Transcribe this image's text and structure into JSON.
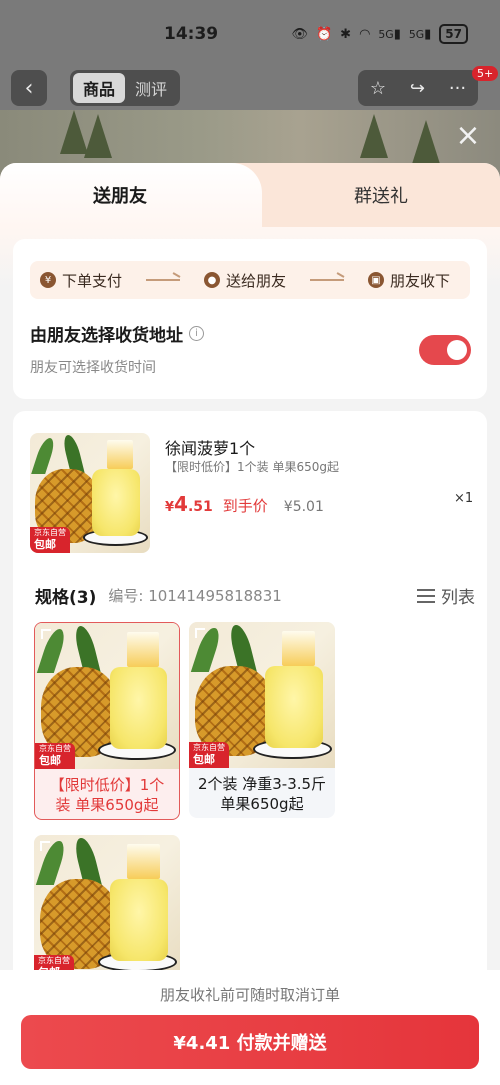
{
  "status_bar": {
    "time": "14:39",
    "battery": "57",
    "signal": "5G"
  },
  "top_nav": {
    "tabs": [
      {
        "label": "商品",
        "active": true
      },
      {
        "label": "测评",
        "active": false
      }
    ],
    "badge": "5+"
  },
  "sheet": {
    "tabs": [
      {
        "label": "送朋友",
        "active": true
      },
      {
        "label": "群送礼",
        "active": false
      }
    ],
    "flow": [
      {
        "label": "下单支付",
        "icon": "yuan-icon"
      },
      {
        "label": "送给朋友",
        "icon": "chat-icon"
      },
      {
        "label": "朋友收下",
        "icon": "gift-icon"
      }
    ],
    "address": {
      "title": "由朋友选择收货地址",
      "subtitle": "朋友可选择收货时间",
      "toggle_on": true
    },
    "product": {
      "name": "徐闻菠萝1个",
      "spec": "【限时低价】1个装 单果650g起",
      "price_symbol": "¥",
      "price_int": "4",
      "price_dec": ".51",
      "price_label": "到手价",
      "original_price": "¥5.01",
      "quantity": "×1",
      "tag_line1": "京东自营",
      "tag_line2": "包邮"
    },
    "specs": {
      "title": "规格(3)",
      "code": "编号: 10141495818831",
      "list_label": "列表",
      "options": [
        {
          "text": "【限时低价】1个装 单果650g起",
          "selected": true
        },
        {
          "text": "2个装 净重3-3.5斤 单果650g起",
          "selected": false
        },
        {
          "text": "",
          "selected": false
        }
      ]
    }
  },
  "footer": {
    "note": "朋友收礼前可随时取消订单",
    "pay_button": "¥4.41 付款并赠送"
  },
  "colors": {
    "accent_red": "#e5484d",
    "flow_bg": "#fdf1e9",
    "tab_bg": "#fbe6d9"
  }
}
